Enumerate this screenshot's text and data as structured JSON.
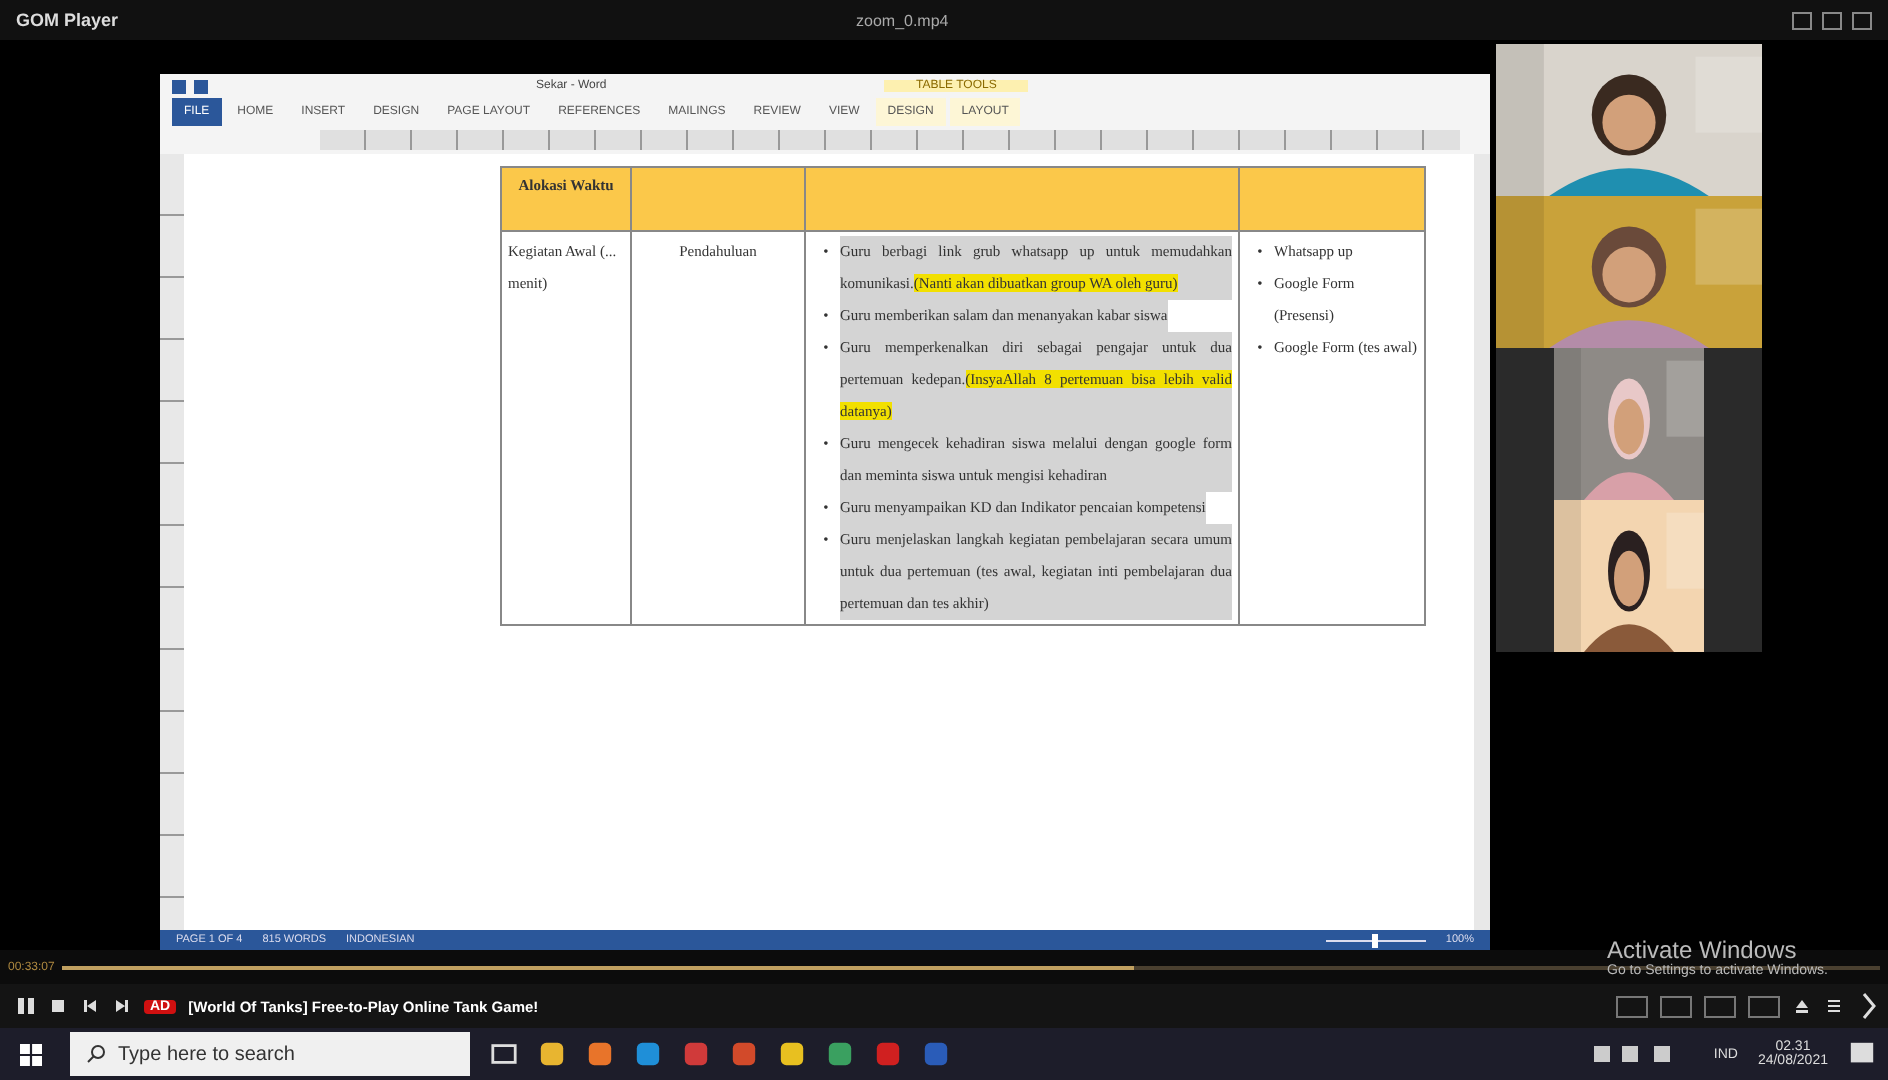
{
  "player": {
    "brand": "GOM Player",
    "file_title": "zoom_0.mp4"
  },
  "word": {
    "title": "Sekar - Word",
    "context_tab_group": "TABLE TOOLS",
    "tabs": [
      {
        "label": "FILE",
        "selected": true,
        "context": false
      },
      {
        "label": "HOME",
        "selected": false,
        "context": false
      },
      {
        "label": "INSERT",
        "selected": false,
        "context": false
      },
      {
        "label": "DESIGN",
        "selected": false,
        "context": false
      },
      {
        "label": "PAGE LAYOUT",
        "selected": false,
        "context": false
      },
      {
        "label": "REFERENCES",
        "selected": false,
        "context": false
      },
      {
        "label": "MAILINGS",
        "selected": false,
        "context": false
      },
      {
        "label": "REVIEW",
        "selected": false,
        "context": false
      },
      {
        "label": "VIEW",
        "selected": false,
        "context": false
      },
      {
        "label": "DESIGN",
        "selected": false,
        "context": true
      },
      {
        "label": "LAYOUT",
        "selected": false,
        "context": true
      }
    ],
    "table": {
      "header": [
        "Alokasi Waktu"
      ],
      "activity": "Kegiatan Awal (... menit)",
      "stage": "Pendahuluan",
      "steps": [
        {
          "bullet": "•",
          "text": "Guru berbagi link grub whatsapp up untuk memudahkan komunikasi.",
          "highlight": "(Nanti akan dibuatkan group WA oleh guru)"
        },
        {
          "bullet": "•",
          "text": "Guru memberikan salam dan menanyakan kabar siswa"
        },
        {
          "bullet": "•",
          "text": "Guru memperkenalkan diri sebagai pengajar untuk dua pertemuan kedepan.",
          "highlight": "(InsyaAllah 8 pertemuan bisa lebih valid datanya)"
        },
        {
          "bullet": "•",
          "text": "Guru mengecek kehadiran siswa melalui dengan google form dan meminta siswa untuk mengisi kehadiran"
        },
        {
          "bullet": "•",
          "text": "Guru menyampaikan KD dan Indikator pencaian kompetensi"
        },
        {
          "bullet": "•",
          "text": "Guru menjelaskan langkah kegiatan pembelajaran secara umum untuk dua pertemuan (tes awal, kegiatan inti pembelajaran dua pertemuan dan tes akhir)"
        }
      ],
      "media": [
        {
          "bullet": "•",
          "text": "Whatsapp up"
        },
        {
          "bullet": "•",
          "text": "Google Form (Presensi)"
        },
        {
          "bullet": "•",
          "text": "Google Form (tes awal)"
        }
      ]
    },
    "status": {
      "page": "PAGE 1 OF 4",
      "words": "815 WORDS",
      "language": "INDONESIAN",
      "zoom": "100%",
      "zoom_slider": {
        "level": 0.5
      }
    }
  },
  "playback": {
    "time": "00:33:07",
    "level": 0.59,
    "ad_badge": "AD",
    "ad_text": "[World Of Tanks] Free-to-Play Online Tank Game!"
  },
  "watermark_os": {
    "title": "Activate Windows",
    "subtitle": "Go to Settings to activate Windows."
  },
  "taskbar": {
    "search_placeholder": "Type here to search",
    "language": "IND",
    "time": "02.31",
    "date": "24/08/2021"
  }
}
